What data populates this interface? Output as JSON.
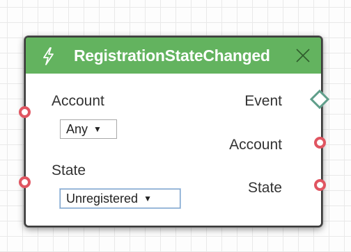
{
  "node": {
    "title": "RegistrationStateChanged",
    "header_color": "#63b35f",
    "icons": {
      "header": "lightning-bolt-icon",
      "close": "close-icon"
    },
    "inputs": [
      {
        "label": "Account",
        "value": "Any",
        "dropdown_icon": "▼"
      },
      {
        "label": "State",
        "value": "Unregistered",
        "dropdown_icon": "▼"
      }
    ],
    "outputs": [
      {
        "label": "Event",
        "port": "diamond"
      },
      {
        "label": "Account",
        "port": "circle"
      },
      {
        "label": "State",
        "port": "circle"
      }
    ],
    "port_colors": {
      "circle": "#e05561",
      "diamond": "#5f9e8a"
    }
  }
}
